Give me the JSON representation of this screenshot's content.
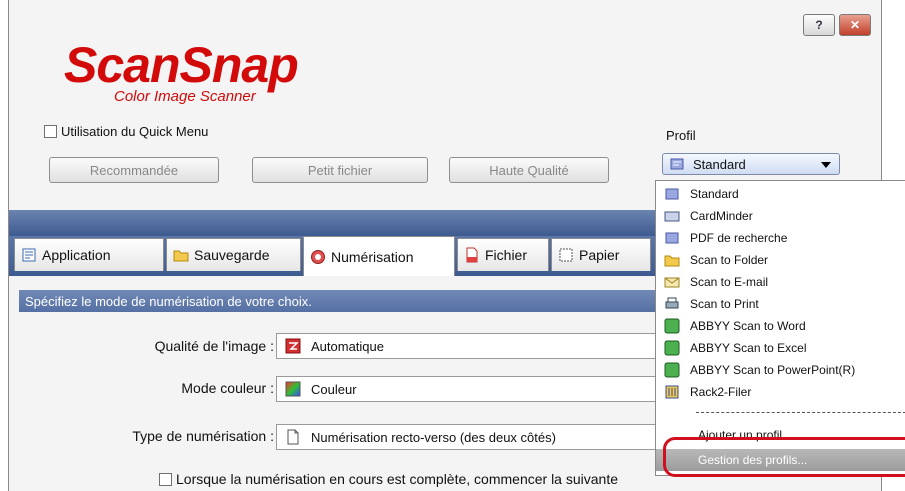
{
  "window": {
    "help_label": "?",
    "close_label": "✕",
    "accent": "#d20a0a"
  },
  "logo": {
    "main": "ScanSnap",
    "sub": "Color Image Scanner"
  },
  "quick_menu": {
    "label": "Utilisation du Quick Menu",
    "checked": false
  },
  "buttons": {
    "recommended": "Recommandée",
    "small_file": "Petit fichier",
    "high_quality": "Haute Qualité"
  },
  "profile": {
    "label": "Profil",
    "selected": "Standard"
  },
  "tabs": [
    {
      "label": "Application",
      "icon": "application-icon"
    },
    {
      "label": "Sauvegarde",
      "icon": "folder-icon"
    },
    {
      "label": "Numérisation",
      "icon": "scan-icon",
      "active": true
    },
    {
      "label": "Fichier",
      "icon": "file-icon"
    },
    {
      "label": "Papier",
      "icon": "paper-icon"
    }
  ],
  "panel": {
    "header": "Spécifiez le mode de numérisation de votre choix.",
    "quality_label": "Qualité de l'image :",
    "quality_value": "Automatique",
    "color_label": "Mode couleur :",
    "color_value": "Couleur",
    "scan_type_label": "Type de numérisation :",
    "scan_type_value": "Numérisation recto-verso (des deux côtés)",
    "continue_label": "Lorsque la numérisation en cours est complète, commencer la suivante"
  },
  "profile_menu": {
    "items": [
      {
        "label": "Standard",
        "icon": "profile-icon"
      },
      {
        "label": "CardMinder",
        "icon": "card-icon"
      },
      {
        "label": "PDF de recherche",
        "icon": "profile-icon"
      },
      {
        "label": "Scan to Folder",
        "icon": "folder-icon"
      },
      {
        "label": "Scan to E-mail",
        "icon": "email-icon"
      },
      {
        "label": "Scan to Print",
        "icon": "printer-icon"
      },
      {
        "label": "ABBYY Scan to Word",
        "icon": "abbyy-icon"
      },
      {
        "label": "ABBYY Scan to Excel",
        "icon": "abbyy-icon"
      },
      {
        "label": "ABBYY Scan to PowerPoint(R)",
        "icon": "abbyy-icon"
      },
      {
        "label": "Rack2-Filer",
        "icon": "rack-icon"
      }
    ],
    "add_profile": "Ajouter un profil",
    "manage_profiles": "Gestion des profils..."
  }
}
